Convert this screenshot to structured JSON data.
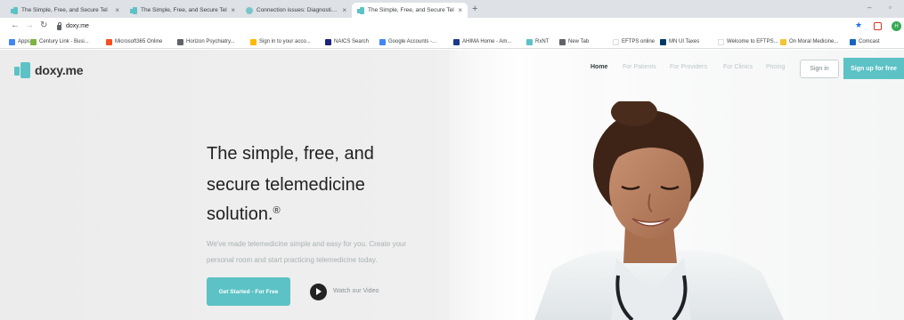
{
  "browser": {
    "tabs": [
      {
        "title": "The Simple, Free, and Secure Tel",
        "icon": "doxy-favicon",
        "active": false
      },
      {
        "title": "The Simple, Free, and Secure Tel",
        "icon": "doxy-favicon",
        "active": false
      },
      {
        "title": "Connection issues: Diagnostic to",
        "icon": "connection-favicon",
        "active": false
      },
      {
        "title": "The Simple, Free, and Secure Tel",
        "icon": "doxy-favicon",
        "active": true
      }
    ],
    "new_tab": "+",
    "url": "doxy.me",
    "profile_initial": "H",
    "bookmarks": [
      {
        "label": "Apps",
        "color": "#4285f4"
      },
      {
        "label": "Century Link - Busi...",
        "color": "#7cb342"
      },
      {
        "label": "Microsoft365 Online",
        "color": "#f25022"
      },
      {
        "label": "Horizon Psychiatry...",
        "color": "#5f6368"
      },
      {
        "label": "Sign in to your acco...",
        "color": "#ffb900"
      },
      {
        "label": "NAICS Search",
        "color": "#1a237e"
      },
      {
        "label": "Google Accounts -...",
        "color": "#4285f4"
      },
      {
        "label": "AHIMA Home - Am...",
        "color": "#1a3a8a"
      },
      {
        "label": "RxNT",
        "color": "#5cc2c5"
      },
      {
        "label": "New Tab",
        "color": "#5f6368"
      },
      {
        "label": "EFTPS online",
        "color": "#ffffff"
      },
      {
        "label": "MN UI Taxes",
        "color": "#003865"
      },
      {
        "label": "Welcome to EFTPS...",
        "color": "#ffffff"
      },
      {
        "label": "On Moral Medicine...",
        "color": "#f4c430"
      },
      {
        "label": "Comcast",
        "color": "#1565c0"
      }
    ]
  },
  "site": {
    "logo_text": "doxy.me",
    "nav": [
      "Home",
      "For Patients",
      "For Providers",
      "For Clinics",
      "Pricing"
    ],
    "sign_in": "Sign in",
    "sign_up": "Sign up for free",
    "hero": {
      "line1": "The simple, free, and",
      "line2": "secure telemedicine",
      "line3": "solution.",
      "registered": "®",
      "sub1": "We've made telemedicine simple and easy for you. Create your",
      "sub2": "personal room and start practicing telemedicine today.",
      "cta": "Get Started - For Free",
      "video": "Watch our Video"
    },
    "accent_color": "#5cc2c5"
  }
}
